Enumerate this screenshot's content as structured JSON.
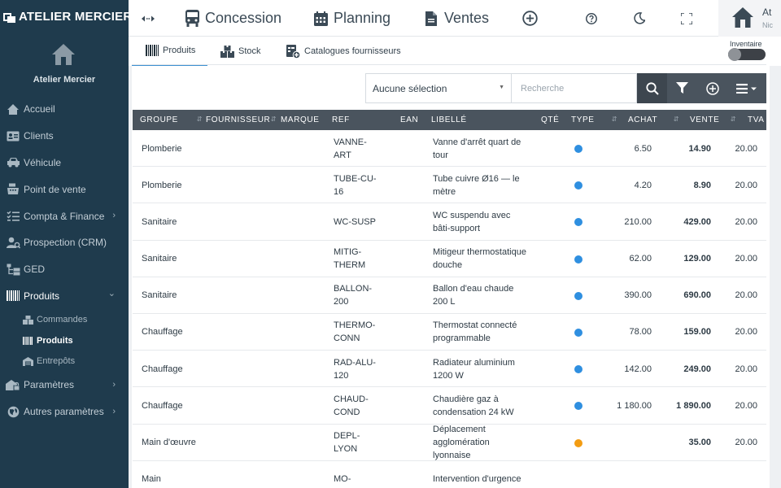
{
  "brand": {
    "name": "ATELIER MERCIER"
  },
  "sidebar": {
    "company": "Atelier Mercier",
    "items": [
      {
        "label": "Accueil",
        "icon": "home-icon"
      },
      {
        "label": "Clients",
        "icon": "id-card-icon"
      },
      {
        "label": "Véhicule",
        "icon": "car-icon"
      },
      {
        "label": "Point de vente",
        "icon": "cash-register-icon"
      },
      {
        "label": "Compta & Finance",
        "icon": "checklist-icon",
        "chevron": "›"
      },
      {
        "label": "Prospection (CRM)",
        "icon": "user-search-icon"
      },
      {
        "label": "GED",
        "icon": "folder-tree-icon"
      },
      {
        "label": "Produits",
        "icon": "barcode-icon",
        "chevron": "⌄"
      },
      {
        "label": "Paramètres",
        "icon": "settings-lock-icon",
        "chevron": "›"
      },
      {
        "label": "Autres paramètres",
        "icon": "globe-icon",
        "chevron": "›"
      }
    ],
    "subitems": [
      {
        "label": "Commandes",
        "icon": "boxes-icon"
      },
      {
        "label": "Produits",
        "icon": "barcode-icon"
      },
      {
        "label": "Entrepôts",
        "icon": "warehouse-icon"
      }
    ]
  },
  "topbar": {
    "concession": "Concession",
    "planning": "Planning",
    "ventes": "Ventes",
    "user_name": "At",
    "user_sub": "Nic"
  },
  "tabs": [
    {
      "label": "Produits",
      "icon": "barcode-icon"
    },
    {
      "label": "Stock",
      "icon": "boxes-icon"
    },
    {
      "label": "Catalogues fournisseurs",
      "icon": "catalog-add-icon"
    }
  ],
  "toggle": {
    "label": "Inventaire"
  },
  "filter": {
    "selection": "Aucune sélection",
    "search_placeholder": "Recherche"
  },
  "colors": {
    "sidebar": "#1f3b4d",
    "header": "#4a545e",
    "accent": "#3b8fd1",
    "dot_product": "#2f8fe0",
    "dot_service": "#f39c12"
  },
  "table": {
    "headers": [
      "GROUPE",
      "FOURNISSEUR",
      "MARQUE",
      "REF",
      "EAN",
      "LIBELLÉ",
      "QTÉ",
      "TYPE",
      "ACHAT",
      "VENTE",
      "TVA"
    ],
    "rows": [
      {
        "groupe": "Plomberie",
        "ref": "VANNE-ART",
        "libelle": "Vanne d'arrêt quart de tour",
        "type": "product",
        "achat": "6.50",
        "vente": "14.90",
        "tva": "20.00"
      },
      {
        "groupe": "Plomberie",
        "ref": "TUBE-CU-16",
        "libelle": "Tube cuivre Ø16 — le mètre",
        "type": "product",
        "achat": "4.20",
        "vente": "8.90",
        "tva": "20.00"
      },
      {
        "groupe": "Sanitaire",
        "ref": "WC-SUSP",
        "libelle": "WC suspendu avec bâti-support",
        "type": "product",
        "achat": "210.00",
        "vente": "429.00",
        "tva": "20.00"
      },
      {
        "groupe": "Sanitaire",
        "ref": "MITIG-THERM",
        "libelle": "Mitigeur thermostatique douche",
        "type": "product",
        "achat": "62.00",
        "vente": "129.00",
        "tva": "20.00"
      },
      {
        "groupe": "Sanitaire",
        "ref": "BALLON-200",
        "libelle": "Ballon d'eau chaude 200 L",
        "type": "product",
        "achat": "390.00",
        "vente": "690.00",
        "tva": "20.00"
      },
      {
        "groupe": "Chauffage",
        "ref": "THERMO-CONN",
        "libelle": "Thermostat connecté programmable",
        "type": "product",
        "achat": "78.00",
        "vente": "159.00",
        "tva": "20.00"
      },
      {
        "groupe": "Chauffage",
        "ref": "RAD-ALU-120",
        "libelle": "Radiateur aluminium 1200 W",
        "type": "product",
        "achat": "142.00",
        "vente": "249.00",
        "tva": "20.00"
      },
      {
        "groupe": "Chauffage",
        "ref": "CHAUD-COND",
        "libelle": "Chaudière gaz à condensation 24 kW",
        "type": "product",
        "achat": "1 180.00",
        "vente": "1 890.00",
        "tva": "20.00"
      },
      {
        "groupe": "Main d'œuvre",
        "ref": "DEPL-LYON",
        "libelle": "Déplacement agglomération lyonnaise",
        "type": "service",
        "achat": "",
        "vente": "35.00",
        "tva": "20.00"
      },
      {
        "groupe": "Main",
        "ref": "MO-",
        "libelle": "Intervention d'urgence",
        "type": "",
        "achat": "",
        "vente": "",
        "tva": ""
      }
    ]
  }
}
